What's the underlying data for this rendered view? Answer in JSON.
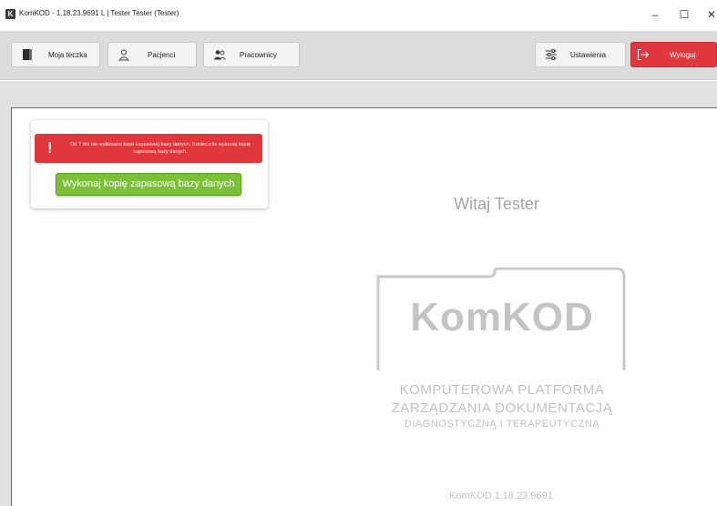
{
  "window": {
    "app_icon_letter": "K",
    "title": "KomKOD - 1.18.23.9691 L | Tester Tester (Tester)",
    "minimize": "–",
    "maximize": "☐",
    "close": "✕"
  },
  "toolbar": {
    "my_folder": "Moja teczka",
    "patients": "Pacjenci",
    "staff": "Pracownicy",
    "settings": "Ustawienia",
    "logout": "Wyloguj"
  },
  "alert": {
    "icon": "!",
    "message": "Od 7 dni nie wykonano kopii zapasowej bazy danych. Koniecznie wykonaj kopię zapasową bazy danych.",
    "button_label": "Wykonaj kopię zapasową bazy danych"
  },
  "main": {
    "welcome": "Witaj Tester",
    "logo_text": "KomKOD",
    "tagline_1": "KOMPUTEROWA PLATFORMA",
    "tagline_2": "ZARZĄDZANIA DOKUMENTACJĄ",
    "tagline_3": "DIAGNOSTYCZNĄ I TERAPEUTYCZNĄ",
    "version": "KomKOD 1.18.23.9691"
  },
  "colors": {
    "alert_red": "#e0373d",
    "action_green": "#7cc03a",
    "logout_red": "#e0383e"
  },
  "icons": {
    "my_folder": "book-icon",
    "patients": "person-icon",
    "staff": "people-icon",
    "settings": "sliders-icon",
    "logout": "logout-icon"
  }
}
